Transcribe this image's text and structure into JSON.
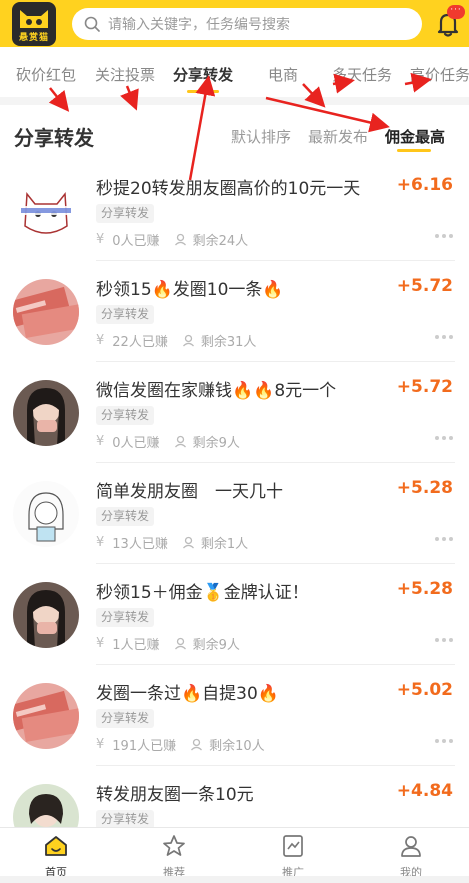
{
  "header": {
    "logo_text": "悬赏猫",
    "search_placeholder": "请输入关键字，任务编号搜索",
    "bell_badge": "···"
  },
  "tabs": [
    {
      "label": "砍价红包",
      "active": false
    },
    {
      "label": "关注投票",
      "active": false
    },
    {
      "label": "分享转发",
      "active": true
    },
    {
      "label": "电商",
      "active": false
    },
    {
      "label": "多天任务",
      "active": false
    },
    {
      "label": "高价任务",
      "active": false
    }
  ],
  "section": {
    "title": "分享转发",
    "sorts": [
      {
        "label": "默认排序",
        "active": false
      },
      {
        "label": "最新发布",
        "active": false
      },
      {
        "label": "佣金最高",
        "active": true
      }
    ]
  },
  "tasks": [
    {
      "title": "秒提20转发朋友圈高价的10元一天",
      "price": "+6.16",
      "tag": "分享转发",
      "earned": "0人已赚",
      "remaining": "剩余24人",
      "avatar": "cat"
    },
    {
      "title": "秒领15🔥发圈10一条🔥",
      "price": "+5.72",
      "tag": "分享转发",
      "earned": "22人已赚",
      "remaining": "剩余31人",
      "avatar": "money"
    },
    {
      "title": "微信发圈在家赚钱🔥🔥8元一个",
      "price": "+5.72",
      "tag": "分享转发",
      "earned": "0人已赚",
      "remaining": "剩余9人",
      "avatar": "girl-dark"
    },
    {
      "title": "简单发朋友圈　一天几十",
      "price": "+5.28",
      "tag": "分享转发",
      "earned": "13人已赚",
      "remaining": "剩余1人",
      "avatar": "sketch"
    },
    {
      "title": "秒领15＋佣金🥇金牌认证！",
      "price": "+5.28",
      "tag": "分享转发",
      "earned": "1人已赚",
      "remaining": "剩余9人",
      "avatar": "girl-dark"
    },
    {
      "title": "发圈一条过🔥自提30🔥",
      "price": "+5.02",
      "tag": "分享转发",
      "earned": "191人已赚",
      "remaining": "剩余10人",
      "avatar": "money"
    },
    {
      "title": "转发朋友圈一条10元",
      "price": "+4.84",
      "tag": "分享转发",
      "earned": "",
      "remaining": "",
      "avatar": "girl-light"
    }
  ],
  "bottom_nav": [
    {
      "label": "首页",
      "icon": "home-icon",
      "active": true
    },
    {
      "label": "推荐",
      "icon": "star-icon",
      "active": false
    },
    {
      "label": "推广",
      "icon": "promote-icon",
      "active": false
    },
    {
      "label": "我的",
      "icon": "user-icon",
      "active": false
    }
  ],
  "colors": {
    "brand_yellow": "#ffd21f",
    "price_orange": "#f26b1d",
    "underline_yellow": "#ffc61a",
    "annotation_red": "#e8231f"
  }
}
